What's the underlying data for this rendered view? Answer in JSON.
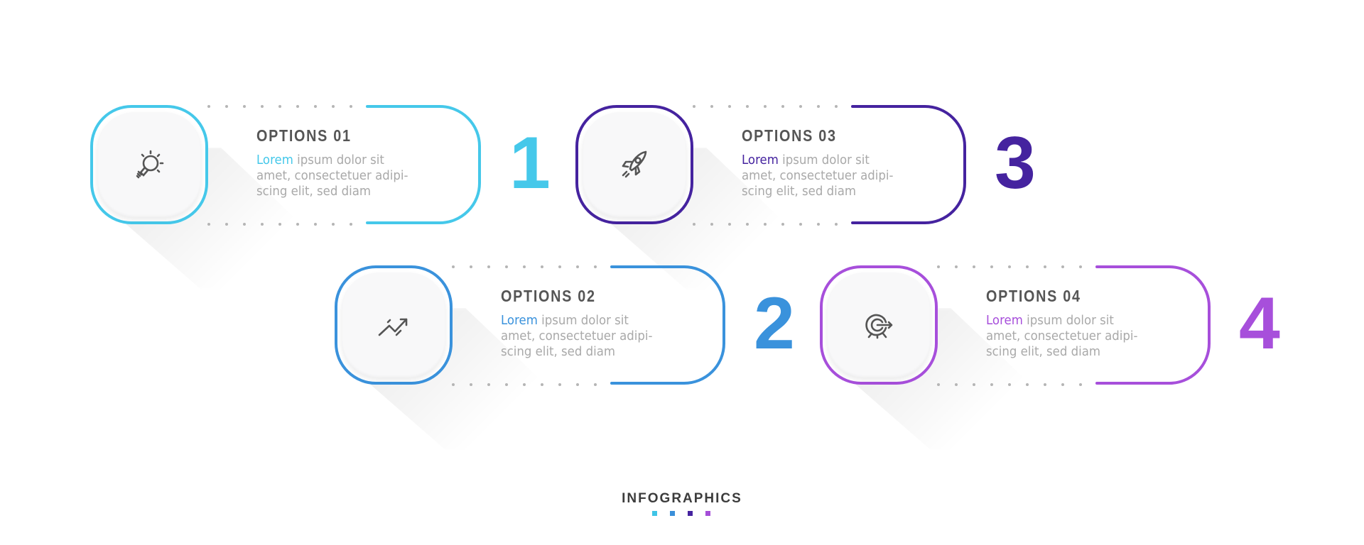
{
  "footer": {
    "title": "INFOGRAPHICS",
    "swatches": [
      "#3fc4e6",
      "#3a8fd9",
      "#45239f",
      "#a54ed8"
    ]
  },
  "options": [
    {
      "id": "01",
      "title": "OPTIONS 01",
      "highlight": "Lorem",
      "text": " ipsum dolor sit amet, consectetuer adipi-scing elit, sed diam",
      "line1_rest": " ipsum dolor sit",
      "line2": "amet, consectetuer adipi-",
      "line3": "scing elit, sed diam",
      "number": "1",
      "icon": "lightbulb-icon",
      "color": "#45c8ea"
    },
    {
      "id": "02",
      "title": "OPTIONS 02",
      "highlight": "Lorem",
      "line1_rest": " ipsum dolor sit",
      "line2": "amet, consectetuer adipi-",
      "line3": "scing elit, sed diam",
      "number": "2",
      "icon": "growth-chart-icon",
      "color": "#3a92dc"
    },
    {
      "id": "03",
      "title": "OPTIONS 03",
      "highlight": "Lorem",
      "line1_rest": " ipsum dolor sit",
      "line2": "amet, consectetuer adipi-",
      "line3": "scing elit, sed diam",
      "number": "3",
      "icon": "rocket-icon",
      "color": "#45239f"
    },
    {
      "id": "04",
      "title": "OPTIONS 04",
      "highlight": "Lorem",
      "line1_rest": " ipsum dolor sit",
      "line2": "amet, consectetuer adipi-",
      "line3": "scing elit, sed diam",
      "number": "4",
      "icon": "target-icon",
      "color": "#a74fdb"
    }
  ]
}
